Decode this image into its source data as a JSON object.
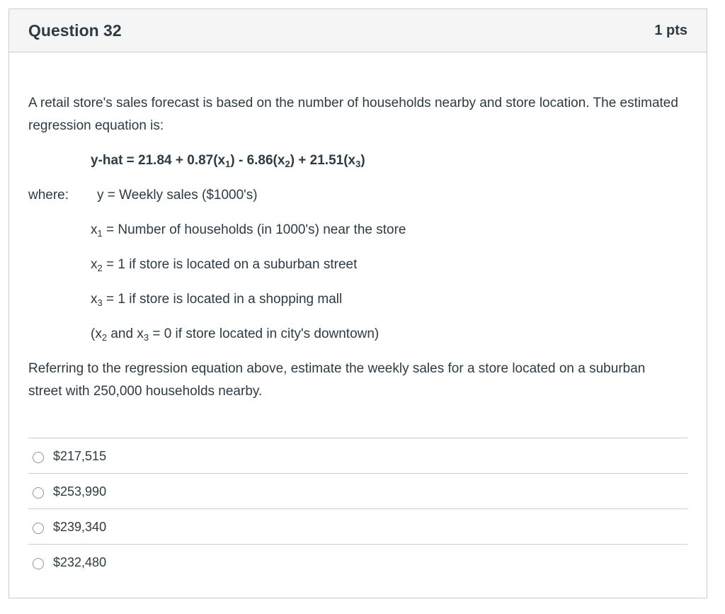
{
  "header": {
    "title": "Question 32",
    "points": "1 pts"
  },
  "body": {
    "para1": "A retail store's sales forecast is based on the number of households nearby and store location. The estimated regression equation is:",
    "equation": {
      "a": "y-hat = 21.84 + 0.87(x",
      "s1": "1",
      "b": ") - 6.86(x",
      "s2": "2",
      "c": ") + 21.51(x",
      "s3": "3",
      "d": ")"
    },
    "where_label": "where:",
    "def_y": "y = Weekly sales ($1000's)",
    "def_x1": {
      "var": "x",
      "sub": "1",
      "text": " = Number of households (in 1000's) near the store"
    },
    "def_x2": {
      "var": "x",
      "sub": "2",
      "text": " = 1 if store is located on a suburban street"
    },
    "def_x3": {
      "var": "x",
      "sub": "3",
      "text": " = 1 if store is located in a shopping mall"
    },
    "def_note": {
      "a": "(x",
      "s2": "2",
      "b": " and x",
      "s3": "3",
      "c": " = 0 if store located in city's downtown)"
    },
    "para2": "Referring to the regression equation above, estimate the weekly sales for a store located on a suburban street with 250,000 households nearby."
  },
  "answers": [
    {
      "label": "$217,515",
      "selected": false
    },
    {
      "label": "$253,990",
      "selected": false
    },
    {
      "label": "$239,340",
      "selected": false
    },
    {
      "label": "$232,480",
      "selected": false
    }
  ],
  "colors": {
    "text": "#2d3b45",
    "border": "#c7cdd1",
    "header_bg": "#f5f5f5"
  }
}
